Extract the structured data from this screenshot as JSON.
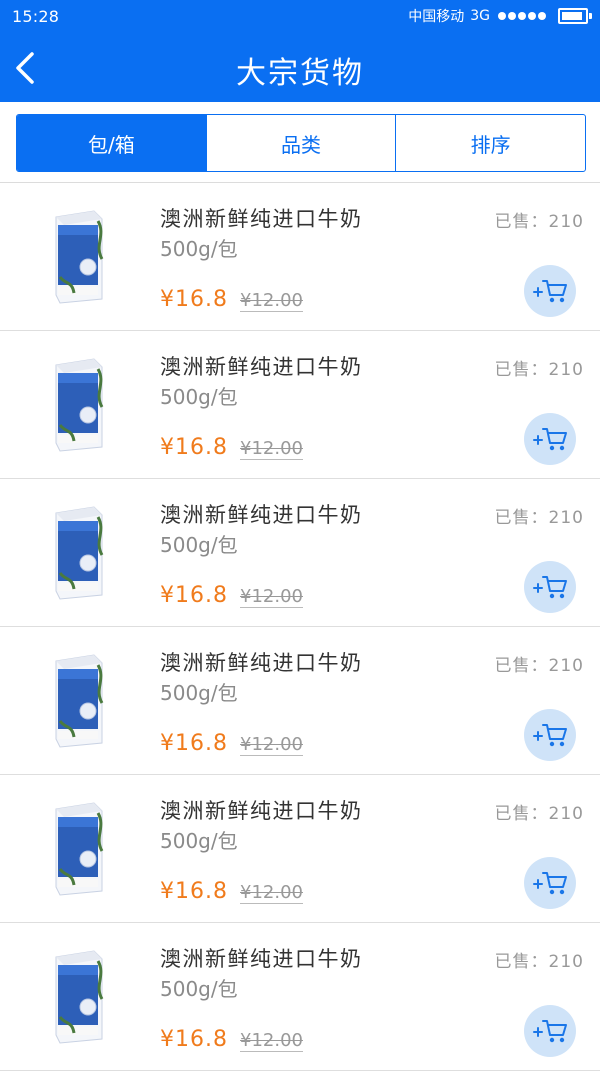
{
  "status": {
    "time": "15:28",
    "carrier": "中国移动",
    "network": "3G"
  },
  "header": {
    "title": "大宗货物"
  },
  "segments": [
    {
      "label": "包/箱"
    },
    {
      "label": "品类"
    },
    {
      "label": "排序"
    }
  ],
  "products": [
    {
      "name": "澳洲新鲜纯进口牛奶",
      "spec": "500g/包",
      "sold": "已售：210",
      "price": "¥16.8",
      "original_price": "¥12.00"
    },
    {
      "name": "澳洲新鲜纯进口牛奶",
      "spec": "500g/包",
      "sold": "已售：210",
      "price": "¥16.8",
      "original_price": "¥12.00"
    },
    {
      "name": "澳洲新鲜纯进口牛奶",
      "spec": "500g/包",
      "sold": "已售：210",
      "price": "¥16.8",
      "original_price": "¥12.00"
    },
    {
      "name": "澳洲新鲜纯进口牛奶",
      "spec": "500g/包",
      "sold": "已售：210",
      "price": "¥16.8",
      "original_price": "¥12.00"
    },
    {
      "name": "澳洲新鲜纯进口牛奶",
      "spec": "500g/包",
      "sold": "已售：210",
      "price": "¥16.8",
      "original_price": "¥12.00"
    },
    {
      "name": "澳洲新鲜纯进口牛奶",
      "spec": "500g/包",
      "sold": "已售：210",
      "price": "¥16.8",
      "original_price": "¥12.00"
    }
  ],
  "colors": {
    "brand": "#0a6ff2",
    "price": "#f07b1c",
    "cart_button_bg": "#cfe3f8"
  },
  "icons": {
    "back": "chevron-left-icon",
    "cart": "add-to-cart-icon",
    "product": "milk-carton-image"
  }
}
